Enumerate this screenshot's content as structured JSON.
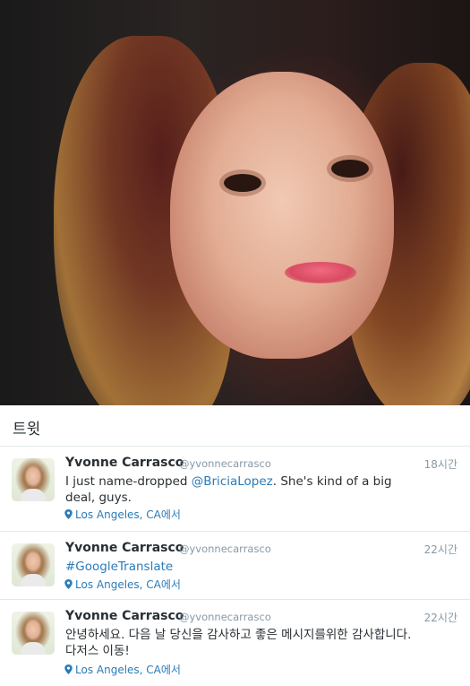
{
  "hero": {
    "image": "profile-header-photo"
  },
  "section": {
    "title": "트윗"
  },
  "colors": {
    "link": "#2b7bb9",
    "muted": "#8899a6",
    "text": "#292f33",
    "divider": "#e1e8ed"
  },
  "tweets": [
    {
      "name": "Yvonne Carrasco",
      "handle": "@yvonnecarrasco",
      "time": "18시간",
      "text_before": "I just name-dropped ",
      "mention": "@BriciaLopez",
      "text_after": ". She's kind of a big deal, guys.",
      "location": "Los Angeles, CA에서",
      "icon": "map-pin-icon"
    },
    {
      "name": "Yvonne Carrasco",
      "handle": "@yvonnecarrasco",
      "time": "22시간",
      "hashtag": "#GoogleTranslate",
      "location": "Los Angeles, CA에서",
      "icon": "map-pin-icon"
    },
    {
      "name": "Yvonne Carrasco",
      "handle": "@yvonnecarrasco",
      "time": "22시간",
      "text": "안녕하세요. 다음 날 당신을 감사하고 좋은 메시지를위한 감사합니다. 다저스 이동!",
      "location": "Los Angeles, CA에서",
      "icon": "map-pin-icon"
    }
  ]
}
